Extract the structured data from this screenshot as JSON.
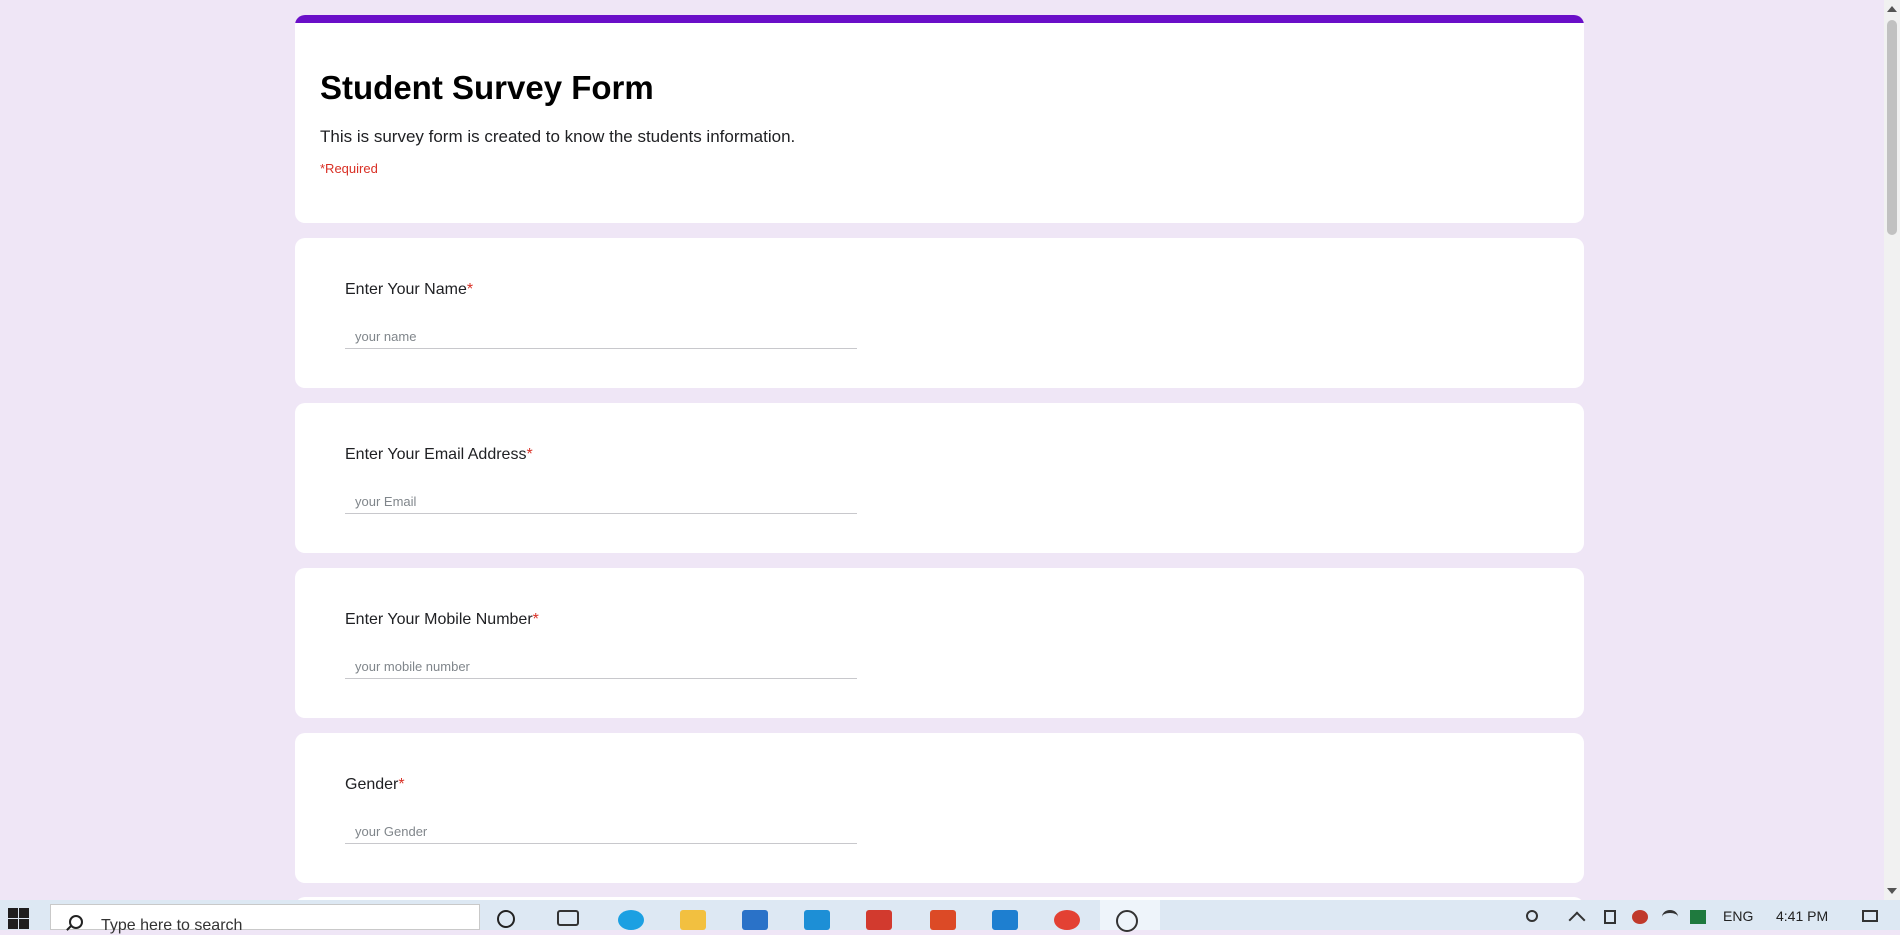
{
  "form": {
    "title": "Student Survey Form",
    "description": "This is survey form is created to know the students information.",
    "required_note": "*Required",
    "accent_color": "#6a0fc8",
    "required_color": "#d93025",
    "background_color": "#efe6f6",
    "questions": [
      {
        "label": "Enter Your Name",
        "star": "*",
        "placeholder": "your name"
      },
      {
        "label": "Enter Your Email Address",
        "star": "*",
        "placeholder": "your Email"
      },
      {
        "label": "Enter Your Mobile Number",
        "star": "*",
        "placeholder": "your mobile number"
      },
      {
        "label": "Gender",
        "star": "*",
        "placeholder": "your Gender"
      }
    ]
  },
  "taskbar": {
    "search_placeholder": "Type here to search",
    "language": "ENG",
    "time": "4:41 PM",
    "pinned_icons": [
      "search-icon",
      "task-view-icon",
      "edge-browser-icon",
      "file-explorer-icon",
      "mail-icon",
      "app-icon",
      "gmail-icon",
      "office-icon",
      "vscode-icon",
      "chrome-icon",
      "snipping-tool-icon"
    ],
    "tray_icons": [
      "people-icon",
      "chevron-up-icon",
      "battery-icon",
      "antivirus-icon",
      "wifi-icon",
      "excel-icon",
      "notification-icon"
    ]
  }
}
